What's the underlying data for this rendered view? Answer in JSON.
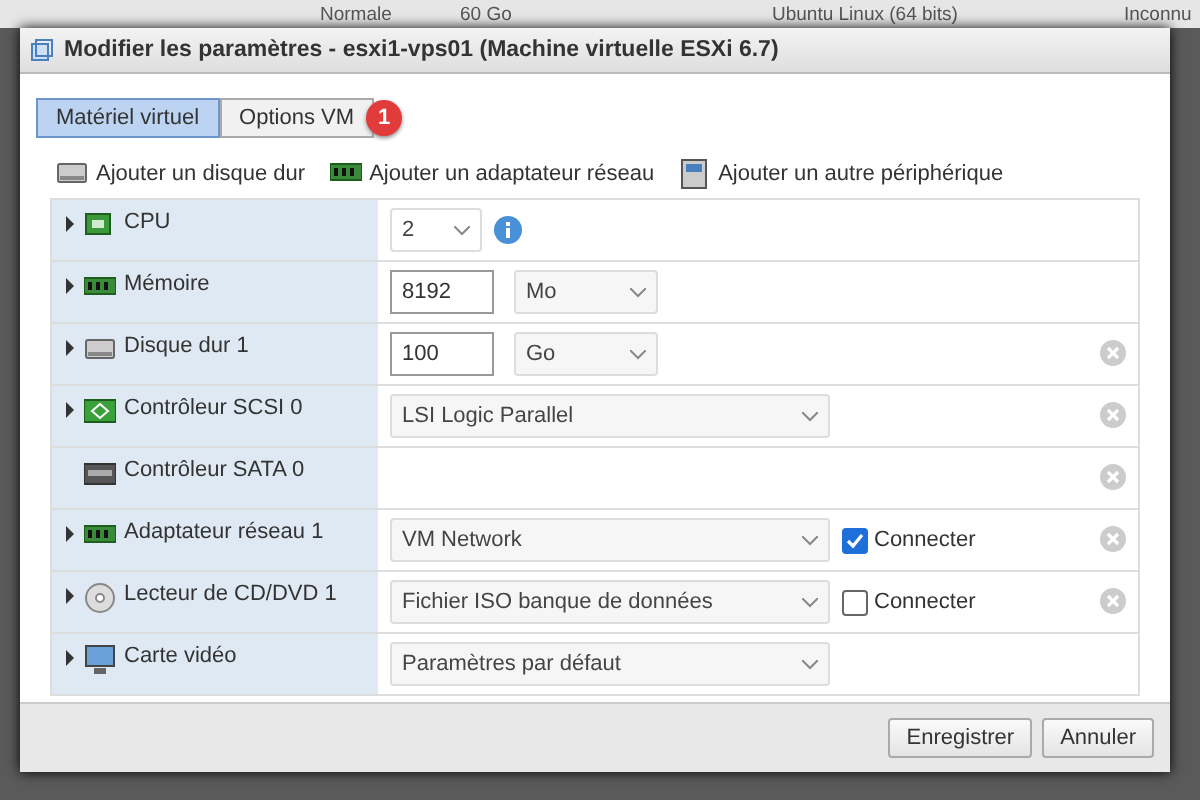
{
  "background_row": {
    "status": "Normale",
    "size": "60 Go",
    "os": "Ubuntu Linux (64 bits)",
    "state": "Inconnu"
  },
  "dialog": {
    "title": "Modifier les paramètres - esxi1-vps01 (Machine virtuelle ESXi 6.7)",
    "tabs": [
      {
        "label": "Matériel virtuel",
        "selected": true
      },
      {
        "label": "Options VM",
        "selected": false
      }
    ],
    "badge": "1",
    "toolbar": [
      "Ajouter un disque dur",
      "Ajouter un adaptateur réseau",
      "Ajouter un autre périphérique"
    ],
    "rows": [
      {
        "label": "CPU",
        "expandable": true,
        "removable": false,
        "controls": [
          {
            "kind": "select-small",
            "value": "2"
          },
          {
            "kind": "info"
          }
        ]
      },
      {
        "label": "Mémoire",
        "expandable": true,
        "removable": false,
        "controls": [
          {
            "kind": "input",
            "value": "8192"
          },
          {
            "kind": "select-unit",
            "value": "Mo"
          }
        ]
      },
      {
        "label": "Disque dur 1",
        "expandable": true,
        "removable": true,
        "controls": [
          {
            "kind": "input",
            "value": "100"
          },
          {
            "kind": "select-unit",
            "value": "Go"
          }
        ]
      },
      {
        "label": "Contrôleur SCSI 0",
        "expandable": true,
        "removable": true,
        "controls": [
          {
            "kind": "select-wide",
            "value": "LSI Logic Parallel"
          }
        ]
      },
      {
        "label": "Contrôleur SATA 0",
        "expandable": false,
        "removable": true,
        "controls": []
      },
      {
        "label": "Adaptateur réseau 1",
        "expandable": true,
        "removable": true,
        "controls": [
          {
            "kind": "select-wide",
            "value": "VM Network"
          },
          {
            "kind": "checkbox",
            "label": "Connecter",
            "checked": true
          }
        ]
      },
      {
        "label": "Lecteur de CD/DVD 1",
        "expandable": true,
        "removable": true,
        "controls": [
          {
            "kind": "select-wide",
            "value": "Fichier ISO banque de données"
          },
          {
            "kind": "checkbox",
            "label": "Connecter",
            "checked": false
          }
        ]
      },
      {
        "label": "Carte vidéo",
        "expandable": true,
        "removable": false,
        "controls": [
          {
            "kind": "select-wide",
            "value": "Paramètres par défaut"
          }
        ]
      }
    ],
    "buttons": [
      "Enregistrer",
      "Annuler"
    ]
  }
}
